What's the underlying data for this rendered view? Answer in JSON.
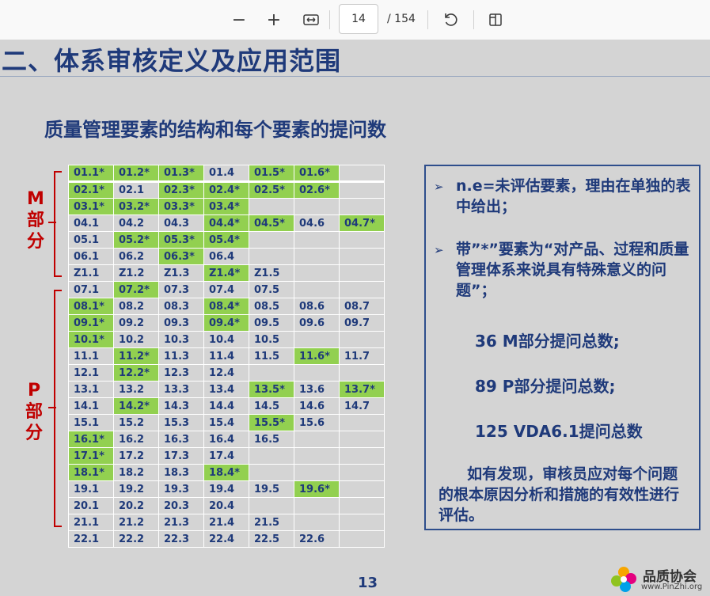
{
  "toolbar": {
    "zoom_out": "−",
    "zoom_in": "+",
    "fit_icon": "fit-width-icon",
    "page_current": "14",
    "page_total": "/ 154",
    "rotate_icon": "rotate-icon",
    "two_page_icon": "two-page-view-icon"
  },
  "slide": {
    "heading": "二、体系审核定义及应用范围",
    "subtitle": "质量管理要素的结构和每个要素的提问数",
    "m_label": [
      "M",
      "部",
      "分"
    ],
    "p_label": [
      "P",
      "部",
      "分"
    ],
    "grid": [
      [
        {
          "t": "01.1*",
          "g": true
        },
        {
          "t": "01.2*",
          "g": true
        },
        {
          "t": "01.3*",
          "g": true
        },
        {
          "t": "01.4",
          "g": false
        },
        {
          "t": "01.5*",
          "g": true
        },
        {
          "t": "01.6*",
          "g": true
        },
        {
          "t": "",
          "g": false
        }
      ],
      [
        {
          "t": "02.1*",
          "g": true
        },
        {
          "t": "02.1",
          "g": false
        },
        {
          "t": "02.3*",
          "g": true
        },
        {
          "t": "02.4*",
          "g": true
        },
        {
          "t": "02.5*",
          "g": true
        },
        {
          "t": "02.6*",
          "g": true
        },
        {
          "t": "",
          "g": false
        }
      ],
      [
        {
          "t": "03.1*",
          "g": true
        },
        {
          "t": "03.2*",
          "g": true
        },
        {
          "t": "03.3*",
          "g": true
        },
        {
          "t": "03.4*",
          "g": true
        },
        {
          "t": "",
          "g": false
        },
        {
          "t": "",
          "g": false
        },
        {
          "t": "",
          "g": false
        }
      ],
      [
        {
          "t": "04.1",
          "g": false
        },
        {
          "t": "04.2",
          "g": false
        },
        {
          "t": "04.3",
          "g": false
        },
        {
          "t": "04.4*",
          "g": true
        },
        {
          "t": "04.5*",
          "g": true
        },
        {
          "t": "04.6",
          "g": false
        },
        {
          "t": "04.7*",
          "g": true
        }
      ],
      [
        {
          "t": "05.1",
          "g": false
        },
        {
          "t": "05.2*",
          "g": true
        },
        {
          "t": "05.3*",
          "g": true
        },
        {
          "t": "05.4*",
          "g": true
        },
        {
          "t": "",
          "g": false
        },
        {
          "t": "",
          "g": false
        },
        {
          "t": "",
          "g": false
        }
      ],
      [
        {
          "t": "06.1",
          "g": false
        },
        {
          "t": "06.2",
          "g": false
        },
        {
          "t": "06.3*",
          "g": true
        },
        {
          "t": "06.4",
          "g": false
        },
        {
          "t": "",
          "g": false
        },
        {
          "t": "",
          "g": false
        },
        {
          "t": "",
          "g": false
        }
      ],
      [
        {
          "t": "Z1.1",
          "g": false
        },
        {
          "t": "Z1.2",
          "g": false
        },
        {
          "t": "Z1.3",
          "g": false
        },
        {
          "t": "Z1.4*",
          "g": true
        },
        {
          "t": "Z1.5",
          "g": false
        },
        {
          "t": "",
          "g": false
        },
        {
          "t": "",
          "g": false
        }
      ],
      [
        {
          "t": "07.1",
          "g": false
        },
        {
          "t": "07.2*",
          "g": true
        },
        {
          "t": "07.3",
          "g": false
        },
        {
          "t": "07.4",
          "g": false
        },
        {
          "t": "07.5",
          "g": false
        },
        {
          "t": "",
          "g": false
        },
        {
          "t": "",
          "g": false
        }
      ],
      [
        {
          "t": "08.1*",
          "g": true
        },
        {
          "t": "08.2",
          "g": false
        },
        {
          "t": "08.3",
          "g": false
        },
        {
          "t": "08.4*",
          "g": true
        },
        {
          "t": "08.5",
          "g": false
        },
        {
          "t": "08.6",
          "g": false
        },
        {
          "t": "08.7",
          "g": false
        }
      ],
      [
        {
          "t": "09.1*",
          "g": true
        },
        {
          "t": "09.2",
          "g": false
        },
        {
          "t": "09.3",
          "g": false
        },
        {
          "t": "09.4*",
          "g": true
        },
        {
          "t": "09.5",
          "g": false
        },
        {
          "t": "09.6",
          "g": false
        },
        {
          "t": "09.7",
          "g": false
        }
      ],
      [
        {
          "t": "10.1*",
          "g": true
        },
        {
          "t": "10.2",
          "g": false
        },
        {
          "t": "10.3",
          "g": false
        },
        {
          "t": "10.4",
          "g": false
        },
        {
          "t": "10.5",
          "g": false
        },
        {
          "t": "",
          "g": false
        },
        {
          "t": "",
          "g": false
        }
      ],
      [
        {
          "t": "11.1",
          "g": false
        },
        {
          "t": "11.2*",
          "g": true
        },
        {
          "t": "11.3",
          "g": false
        },
        {
          "t": "11.4",
          "g": false
        },
        {
          "t": "11.5",
          "g": false
        },
        {
          "t": "11.6*",
          "g": true
        },
        {
          "t": "11.7",
          "g": false
        }
      ],
      [
        {
          "t": "12.1",
          "g": false
        },
        {
          "t": "12.2*",
          "g": true
        },
        {
          "t": "12.3",
          "g": false
        },
        {
          "t": "12.4",
          "g": false
        },
        {
          "t": "",
          "g": false
        },
        {
          "t": "",
          "g": false
        },
        {
          "t": "",
          "g": false
        }
      ],
      [
        {
          "t": "13.1",
          "g": false
        },
        {
          "t": "13.2",
          "g": false
        },
        {
          "t": "13.3",
          "g": false
        },
        {
          "t": "13.4",
          "g": false
        },
        {
          "t": "13.5*",
          "g": true
        },
        {
          "t": "13.6",
          "g": false
        },
        {
          "t": "13.7*",
          "g": true
        }
      ],
      [
        {
          "t": "14.1",
          "g": false
        },
        {
          "t": "14.2*",
          "g": true
        },
        {
          "t": "14.3",
          "g": false
        },
        {
          "t": "14.4",
          "g": false
        },
        {
          "t": "14.5",
          "g": false
        },
        {
          "t": "14.6",
          "g": false
        },
        {
          "t": "14.7",
          "g": false
        }
      ],
      [
        {
          "t": "15.1",
          "g": false
        },
        {
          "t": "15.2",
          "g": false
        },
        {
          "t": "15.3",
          "g": false
        },
        {
          "t": "15.4",
          "g": false
        },
        {
          "t": "15.5*",
          "g": true
        },
        {
          "t": "15.6",
          "g": false
        },
        {
          "t": "",
          "g": false
        }
      ],
      [
        {
          "t": "16.1*",
          "g": true
        },
        {
          "t": "16.2",
          "g": false
        },
        {
          "t": "16.3",
          "g": false
        },
        {
          "t": "16.4",
          "g": false
        },
        {
          "t": "16.5",
          "g": false
        },
        {
          "t": "",
          "g": false
        },
        {
          "t": "",
          "g": false
        }
      ],
      [
        {
          "t": "17.1*",
          "g": true
        },
        {
          "t": "17.2",
          "g": false
        },
        {
          "t": "17.3",
          "g": false
        },
        {
          "t": "17.4",
          "g": false
        },
        {
          "t": "",
          "g": false
        },
        {
          "t": "",
          "g": false
        },
        {
          "t": "",
          "g": false
        }
      ],
      [
        {
          "t": "18.1*",
          "g": true
        },
        {
          "t": "18.2",
          "g": false
        },
        {
          "t": "18.3",
          "g": false
        },
        {
          "t": "18.4*",
          "g": true
        },
        {
          "t": "",
          "g": false
        },
        {
          "t": "",
          "g": false
        },
        {
          "t": "",
          "g": false
        }
      ],
      [
        {
          "t": "19.1",
          "g": false
        },
        {
          "t": "19.2",
          "g": false
        },
        {
          "t": "19.3",
          "g": false
        },
        {
          "t": "19.4",
          "g": false
        },
        {
          "t": "19.5",
          "g": false
        },
        {
          "t": "19.6*",
          "g": true
        },
        {
          "t": "",
          "g": false
        }
      ],
      [
        {
          "t": "20.1",
          "g": false
        },
        {
          "t": "20.2",
          "g": false
        },
        {
          "t": "20.3",
          "g": false
        },
        {
          "t": "20.4",
          "g": false
        },
        {
          "t": "",
          "g": false
        },
        {
          "t": "",
          "g": false
        },
        {
          "t": "",
          "g": false
        }
      ],
      [
        {
          "t": "21.1",
          "g": false
        },
        {
          "t": "21.2",
          "g": false
        },
        {
          "t": "21.3",
          "g": false
        },
        {
          "t": "21.4",
          "g": false
        },
        {
          "t": "21.5",
          "g": false
        },
        {
          "t": "",
          "g": false
        },
        {
          "t": "",
          "g": false
        }
      ],
      [
        {
          "t": "22.1",
          "g": false
        },
        {
          "t": "22.2",
          "g": false
        },
        {
          "t": "22.3",
          "g": false
        },
        {
          "t": "22.4",
          "g": false
        },
        {
          "t": "22.5",
          "g": false
        },
        {
          "t": "22.6",
          "g": false
        },
        {
          "t": "",
          "g": false
        }
      ]
    ],
    "info": {
      "bullet1": "n.e=未评估要素，理由在单独的表中给出；",
      "bullet2": "带”*”要素为“对产品、过程和质量管理体系来说具有特殊意义的问题”；",
      "stat1": "36  M部分提问总数;",
      "stat2": "89  P部分提问总数;",
      "stat3": "125  VDA6.1提问总数",
      "note": "如有发现，审核员应对每个问题的根本原因分析和措施的有效性进行评估。"
    },
    "page_number": "13",
    "logo": {
      "name": "品质协会",
      "url": "www.PinZhi.org"
    }
  },
  "colors": {
    "green": "#92d050",
    "navy": "#1f3a7a",
    "red": "#c00000",
    "slide_bg": "#d4d4d4"
  }
}
